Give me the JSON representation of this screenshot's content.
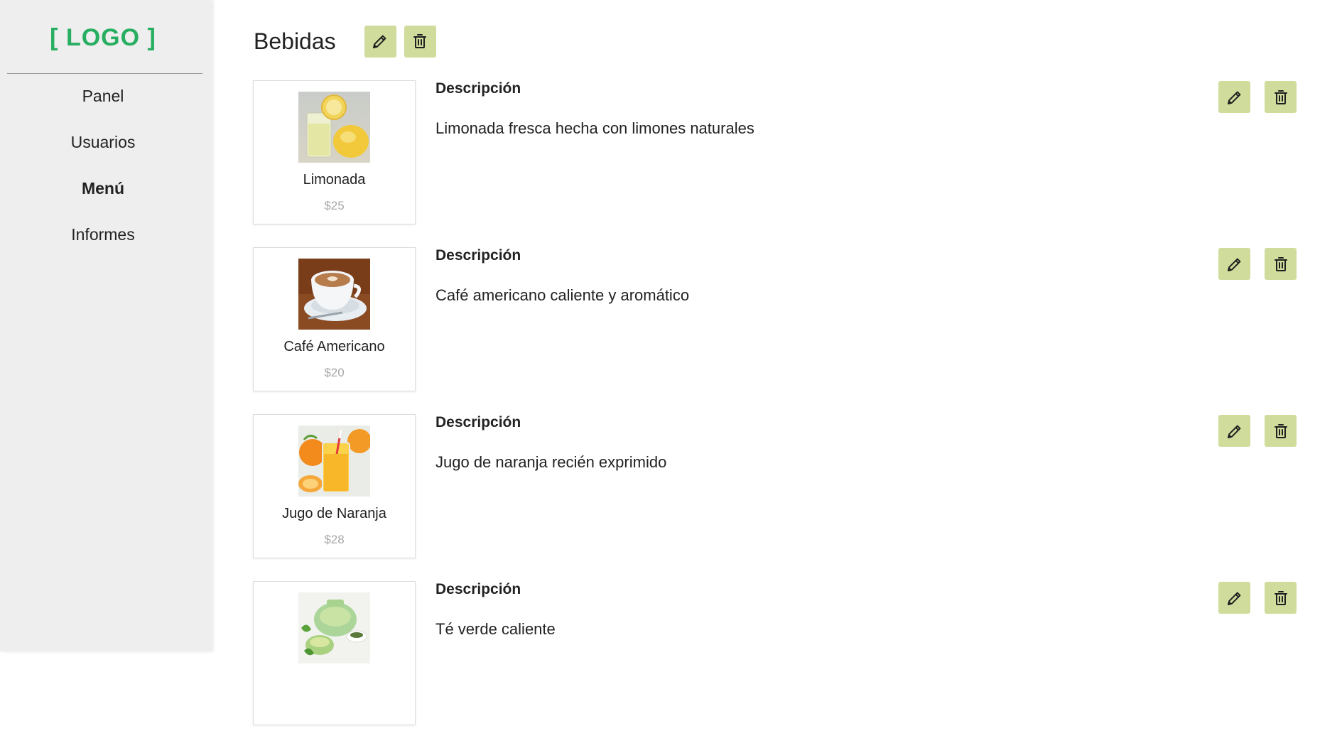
{
  "sidebar": {
    "logo": "[ LOGO ]",
    "nav": [
      {
        "label": "Panel",
        "active": false
      },
      {
        "label": "Usuarios",
        "active": false
      },
      {
        "label": "Menú",
        "active": true
      },
      {
        "label": "Informes",
        "active": false
      }
    ]
  },
  "main": {
    "category": {
      "title": "Bebidas",
      "edit_icon": "pencil-icon",
      "delete_icon": "trash-icon"
    },
    "description_label": "Descripción",
    "items": [
      {
        "name": "Limonada",
        "price": "$25",
        "description": "Limonada fresca hecha con limones naturales",
        "image": "lemonade-image"
      },
      {
        "name": "Café Americano",
        "price": "$20",
        "description": "Café americano caliente y aromático",
        "image": "coffee-cup-image"
      },
      {
        "name": "Jugo de Naranja",
        "price": "$28",
        "description": "Jugo de naranja recién exprimido",
        "image": "orange-juice-image"
      },
      {
        "name": "",
        "price": "",
        "description": "Té verde caliente",
        "image": "green-tea-image"
      }
    ]
  },
  "colors": {
    "accent_logo": "#27ae60",
    "action_button": "#cfdc9c",
    "sidebar_bg": "#eeeeee",
    "price_text": "#a7a7a7"
  }
}
